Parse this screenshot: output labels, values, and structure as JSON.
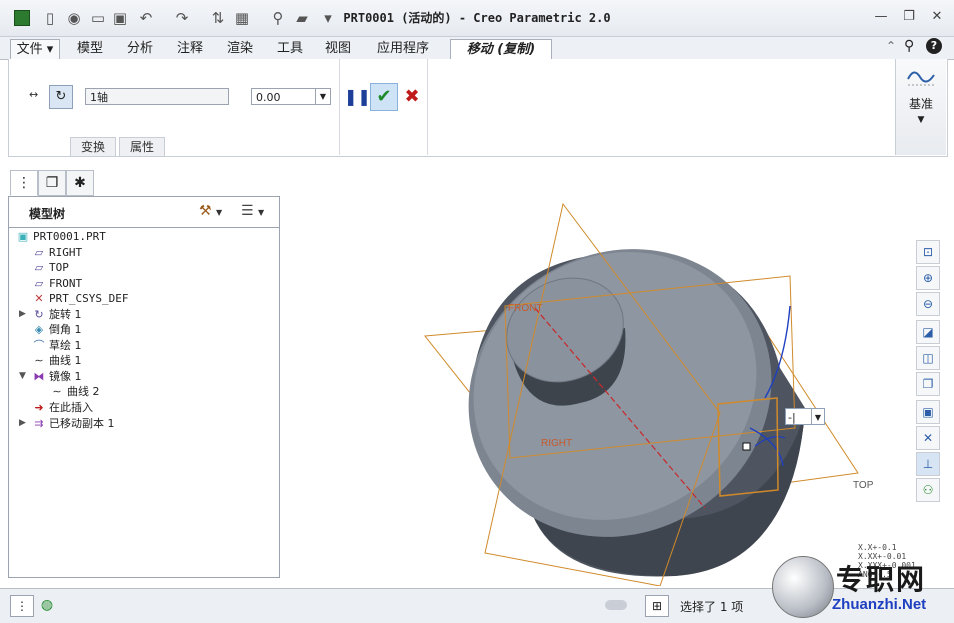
{
  "window": {
    "title": "PRT0001 (活动的) - Creo Parametric 2.0"
  },
  "quick_access": {
    "icons": [
      "app-icon",
      "new-icon",
      "open-icon",
      "open-folder-icon",
      "save-icon",
      "undo-icon",
      "redo-icon",
      "regenerate-icon",
      "windows-icon",
      "find-icon",
      "folder-icon",
      "customize-icon"
    ]
  },
  "tabs": [
    {
      "label": "文件",
      "kind": "file"
    },
    {
      "label": "模型"
    },
    {
      "label": "分析"
    },
    {
      "label": "注释"
    },
    {
      "label": "渲染"
    },
    {
      "label": "工具"
    },
    {
      "label": "视图"
    },
    {
      "label": "应用程序"
    },
    {
      "label": "移动 (复制)",
      "kind": "active"
    }
  ],
  "ribbon": {
    "reference_value": "1轴",
    "amount_value": "0.00",
    "subtabs": [
      "变换",
      "属性"
    ],
    "datum_label": "基准",
    "colors": {
      "pause": "#1d3f9a",
      "confirm": "#1f8a2a",
      "cancel": "#c01a1a"
    }
  },
  "model_tree": {
    "title": "模型树",
    "items": [
      {
        "label": "PRT0001.PRT",
        "icon": "part-icon",
        "level": 0
      },
      {
        "label": "RIGHT",
        "icon": "datum-plane-icon",
        "level": 1
      },
      {
        "label": "TOP",
        "icon": "datum-plane-icon",
        "level": 1
      },
      {
        "label": "FRONT",
        "icon": "datum-plane-icon",
        "level": 1
      },
      {
        "label": "PRT_CSYS_DEF",
        "icon": "csys-icon",
        "level": 1
      },
      {
        "label": "旋转 1",
        "icon": "revolve-icon",
        "level": 1,
        "expand": "▶"
      },
      {
        "label": "倒角 1",
        "icon": "chamfer-icon",
        "level": 1
      },
      {
        "label": "草绘 1",
        "icon": "sketch-icon",
        "level": 1
      },
      {
        "label": "曲线 1",
        "icon": "curve-icon",
        "level": 1
      },
      {
        "label": "镜像 1",
        "icon": "mirror-icon",
        "level": 1,
        "expand": "▼"
      },
      {
        "label": "曲线 2",
        "icon": "curve-icon",
        "level": 2
      },
      {
        "label": "在此插入",
        "icon": "insert-arrow-icon",
        "level": 1
      },
      {
        "label": "已移动副本 1",
        "icon": "moved-copy-icon",
        "level": 1,
        "expand": "▶"
      }
    ]
  },
  "viewport": {
    "labels": {
      "front": "FRONT",
      "right": "RIGHT",
      "top": "TOP"
    },
    "dim_box_value": "-|",
    "tolerance_lines": [
      "X.X+-0.1",
      "X.XX+-0.01",
      "X.XXX+-0.001",
      "ANG+-.5"
    ],
    "colors": {
      "datum": "#d08a2a",
      "body": "#4e5560",
      "face": "#8e96a2",
      "axis": "#c8282a"
    }
  },
  "status": {
    "selection_text": "选择了 1 项"
  },
  "watermark": {
    "cn": "专职网",
    "url": "Zhuanzhi.Net"
  }
}
